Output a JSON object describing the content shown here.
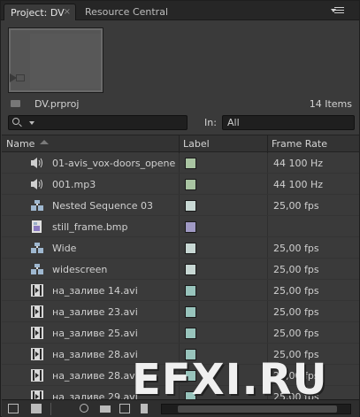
{
  "tabs": [
    {
      "label": "Project: DV",
      "close": "×"
    },
    {
      "label": "Resource Central"
    }
  ],
  "project": {
    "name": "DV.prproj",
    "item_count": "14 Items"
  },
  "search": {
    "value": "",
    "in_label": "In:",
    "in_value": "All"
  },
  "columns": {
    "name": "Name",
    "label": "Label",
    "frame_rate": "Frame Rate"
  },
  "rows": [
    {
      "icon": "audio-icon",
      "name": "01-avis_vox-doors_opene",
      "label_color": "#a9c4a2",
      "frame_rate": "44 100 Hz"
    },
    {
      "icon": "audio-icon",
      "name": "001.mp3",
      "label_color": "#a9c4a2",
      "frame_rate": "44 100 Hz"
    },
    {
      "icon": "sequence-icon",
      "name": "Nested Sequence 03",
      "label_color": "#c8d8d4",
      "frame_rate": "25,00 fps"
    },
    {
      "icon": "still-image-icon",
      "name": "still_frame.bmp",
      "label_color": "#a09ac4",
      "frame_rate": ""
    },
    {
      "icon": "sequence-icon",
      "name": "Wide",
      "label_color": "#c8d8d4",
      "frame_rate": "25,00 fps"
    },
    {
      "icon": "sequence-icon",
      "name": "widescreen",
      "label_color": "#c8d8d4",
      "frame_rate": "25,00 fps"
    },
    {
      "icon": "video-icon",
      "name": "на_заливе 14.avi",
      "label_color": "#98c4bc",
      "frame_rate": "25,00 fps"
    },
    {
      "icon": "video-icon",
      "name": "на_заливе 23.avi",
      "label_color": "#98c4bc",
      "frame_rate": "25,00 fps"
    },
    {
      "icon": "video-icon",
      "name": "на_заливе 25.avi",
      "label_color": "#98c4bc",
      "frame_rate": "25,00 fps"
    },
    {
      "icon": "video-icon",
      "name": "на_заливе 28.avi",
      "label_color": "#98c4bc",
      "frame_rate": "25,00 fps"
    },
    {
      "icon": "video-icon",
      "name": "на_заливе 28.avi",
      "label_color": "#98c4bc",
      "frame_rate": "25,00 fps"
    },
    {
      "icon": "video-icon",
      "name": "на_заливе 29.avi",
      "label_color": "#98c4bc",
      "frame_rate": "25,00 fps"
    }
  ],
  "toolbar": {
    "icons": [
      "list-view-icon",
      "icon-view-icon",
      "find-icon",
      "new-bin-icon",
      "new-item-icon",
      "clear-icon"
    ]
  },
  "watermark": "EFXI.RU"
}
